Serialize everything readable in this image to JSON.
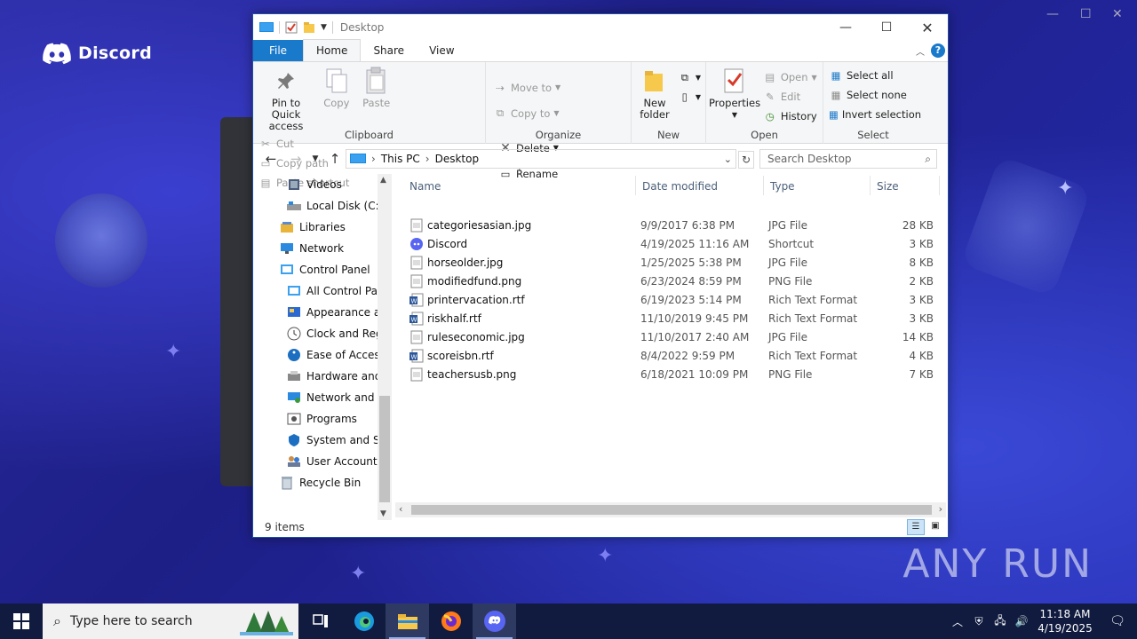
{
  "desktop": {
    "discord_logo": "Discord",
    "watermark": "ANY RUN"
  },
  "window": {
    "title": "Desktop",
    "tabs": [
      {
        "label": "File"
      },
      {
        "label": "Home"
      },
      {
        "label": "Share"
      },
      {
        "label": "View"
      }
    ],
    "ribbon": {
      "clipboard": {
        "label": "Clipboard",
        "pin": "Pin to Quick access",
        "pin_line1": "Pin to Quick",
        "pin_line2": "access",
        "copy": "Copy",
        "paste": "Paste",
        "cut": "Cut",
        "copy_path": "Copy path",
        "paste_shortcut": "Paste shortcut"
      },
      "organize": {
        "label": "Organize",
        "move_to": "Move to",
        "copy_to": "Copy to",
        "delete": "Delete",
        "rename": "Rename"
      },
      "new": {
        "label": "New",
        "new_folder_line1": "New",
        "new_folder_line2": "folder"
      },
      "open": {
        "label": "Open",
        "properties": "Properties",
        "open": "Open",
        "edit": "Edit",
        "history": "History"
      },
      "select": {
        "label": "Select",
        "select_all": "Select all",
        "select_none": "Select none",
        "invert": "Invert selection"
      }
    },
    "address": {
      "crumbs": [
        "This PC",
        "Desktop"
      ],
      "search_placeholder": "Search Desktop"
    },
    "nav": [
      {
        "label": "Videos",
        "icon": "videos-icon"
      },
      {
        "label": "Local Disk (C:)",
        "icon": "disk-icon"
      },
      {
        "label": "Libraries",
        "icon": "libraries-icon"
      },
      {
        "label": "Network",
        "icon": "network-icon"
      },
      {
        "label": "Control Panel",
        "icon": "control-panel-icon"
      },
      {
        "label": "All Control Par",
        "icon": "control-panel-icon"
      },
      {
        "label": "Appearance an",
        "icon": "appearance-icon"
      },
      {
        "label": "Clock and Regi",
        "icon": "clock-icon"
      },
      {
        "label": "Ease of Access",
        "icon": "ease-access-icon"
      },
      {
        "label": "Hardware and",
        "icon": "hardware-icon"
      },
      {
        "label": "Network and Ir",
        "icon": "network-icon"
      },
      {
        "label": "Programs",
        "icon": "programs-icon"
      },
      {
        "label": "System and Se",
        "icon": "system-icon"
      },
      {
        "label": "User Accounts",
        "icon": "users-icon"
      },
      {
        "label": "Recycle Bin",
        "icon": "recycle-bin-icon"
      }
    ],
    "columns": {
      "name": "Name",
      "date": "Date modified",
      "type": "Type",
      "size": "Size"
    },
    "files": [
      {
        "name": "categoriesasian.jpg",
        "date": "9/9/2017 6:38 PM",
        "type": "JPG File",
        "size": "28 KB",
        "icon": "image-file-icon"
      },
      {
        "name": "Discord",
        "date": "4/19/2025 11:16 AM",
        "type": "Shortcut",
        "size": "3 KB",
        "icon": "discord-icon"
      },
      {
        "name": "horseolder.jpg",
        "date": "1/25/2025 5:38 PM",
        "type": "JPG File",
        "size": "8 KB",
        "icon": "image-file-icon"
      },
      {
        "name": "modifiedfund.png",
        "date": "6/23/2024 8:59 PM",
        "type": "PNG File",
        "size": "2 KB",
        "icon": "image-file-icon"
      },
      {
        "name": "printervacation.rtf",
        "date": "6/19/2023 5:14 PM",
        "type": "Rich Text Format",
        "size": "3 KB",
        "icon": "word-doc-icon"
      },
      {
        "name": "riskhalf.rtf",
        "date": "11/10/2019 9:45 PM",
        "type": "Rich Text Format",
        "size": "3 KB",
        "icon": "word-doc-icon"
      },
      {
        "name": "ruleseconomic.jpg",
        "date": "11/10/2017 2:40 AM",
        "type": "JPG File",
        "size": "14 KB",
        "icon": "image-file-icon"
      },
      {
        "name": "scoreisbn.rtf",
        "date": "8/4/2022 9:59 PM",
        "type": "Rich Text Format",
        "size": "4 KB",
        "icon": "word-doc-icon"
      },
      {
        "name": "teachersusb.png",
        "date": "6/18/2021 10:09 PM",
        "type": "PNG File",
        "size": "7 KB",
        "icon": "image-file-icon"
      }
    ],
    "status": "9 items"
  },
  "taskbar": {
    "search_placeholder": "Type here to search",
    "time": "11:18 AM",
    "date": "4/19/2025"
  },
  "colors": {
    "accent": "#1979ca",
    "taskbar": "#101b3f",
    "discord": "#5865f2"
  }
}
